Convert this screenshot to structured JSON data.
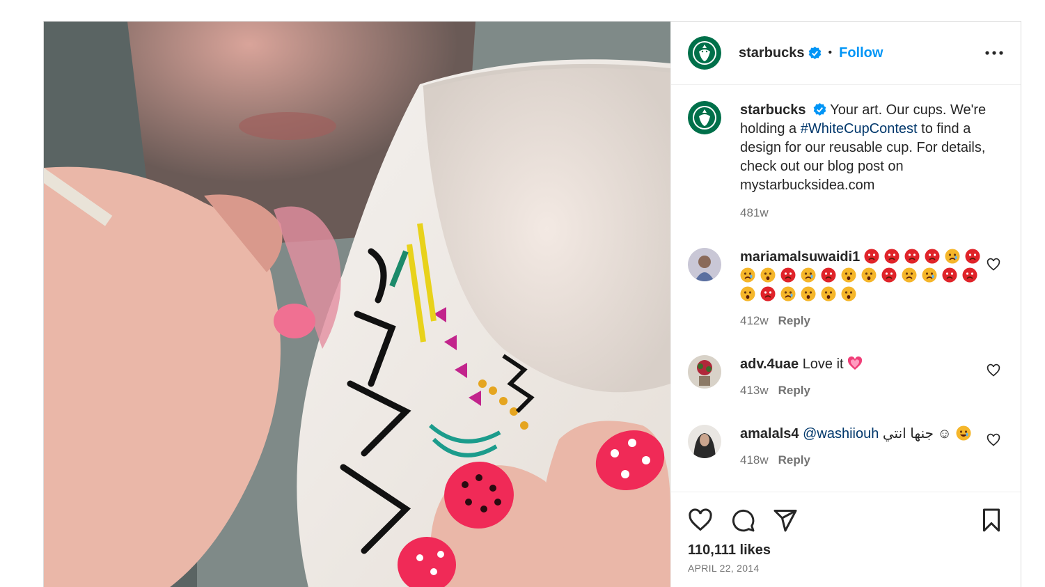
{
  "post": {
    "author": "starbucks",
    "follow_label": "Follow",
    "separator": "•",
    "caption": {
      "username": "starbucks",
      "text_before": "Your art. Our cups. We're holding a ",
      "hashtag": "#WhiteCupContest",
      "text_after": " to find a design for our reusable cup. For details, check out our blog post on mystarbucksidea.com",
      "age": "481w"
    },
    "comments": [
      {
        "username": "mariamalsuwaidi1",
        "text": "",
        "emojis": [
          "angry",
          "angry",
          "angry",
          "angry",
          "crying",
          "angry",
          "crying",
          "shocked",
          "angry",
          "crying",
          "angry",
          "shocked",
          "shocked",
          "angry",
          "worried",
          "crying",
          "angry",
          "angry",
          "shocked",
          "angry",
          "crying",
          "shocked",
          "shocked",
          "shocked"
        ],
        "age": "412w",
        "reply_label": "Reply"
      },
      {
        "username": "adv.4uae",
        "text": "Love it",
        "emojis": [
          "heart-sparkle"
        ],
        "age": "413w",
        "reply_label": "Reply"
      },
      {
        "username": "amalals4",
        "mention": "@washiiouh",
        "text": "جنها انتي ☺",
        "emojis": [
          "laughing"
        ],
        "age": "418w",
        "reply_label": "Reply"
      }
    ],
    "likes": "110,111 likes",
    "date": "APRIL 22, 2014",
    "icons": {
      "like": "heart-icon",
      "comment": "comment-icon",
      "share": "share-icon",
      "save": "bookmark-icon",
      "more": "more-options-icon"
    },
    "colors": {
      "accent": "#0095f6",
      "verified": "#0095f6",
      "link": "#00376b",
      "muted": "#737373",
      "starbucks_green": "#00704a"
    }
  }
}
